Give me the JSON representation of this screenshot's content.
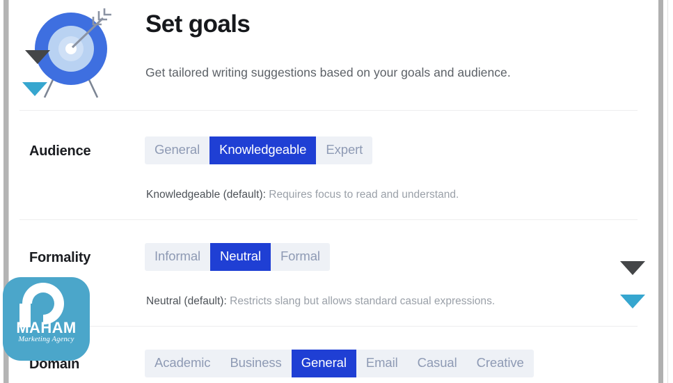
{
  "header": {
    "title": "Set goals",
    "subtitle": "Get tailored writing suggestions based on your goals and audience.",
    "icon": "target-with-arrow-icon"
  },
  "settings": [
    {
      "key": "audience",
      "label": "Audience",
      "options": [
        "General",
        "Knowledgeable",
        "Expert"
      ],
      "selected": "Knowledgeable",
      "description_strong": "Knowledgeable (default):",
      "description_rest": " Requires focus to read and understand."
    },
    {
      "key": "formality",
      "label": "Formality",
      "options": [
        "Informal",
        "Neutral",
        "Formal"
      ],
      "selected": "Neutral",
      "description_strong": "Neutral (default):",
      "description_rest": " Restricts slang but allows standard casual expressions."
    },
    {
      "key": "domain",
      "label": "Domain",
      "options": [
        "Academic",
        "Business",
        "General",
        "Email",
        "Casual",
        "Creative"
      ],
      "selected": "General",
      "description_strong": "",
      "description_rest": ""
    }
  ],
  "overlays": {
    "cursor_dark": "cursor-arrow-dark",
    "cursor_teal": "cursor-arrow-teal"
  },
  "watermark": {
    "name": "MAHAM",
    "tagline": "Marketing Agency",
    "color": "#4ba6ca"
  },
  "colors": {
    "accent_active": "#1f3fd4",
    "segment_track": "#eef1f6",
    "segment_inactive_text": "#8e9ab4",
    "title_text": "#16181c",
    "subtitle_text": "#5b6066",
    "divider": "#ededee",
    "cursor_dark": "#444648",
    "cursor_teal": "#36a6cf"
  }
}
